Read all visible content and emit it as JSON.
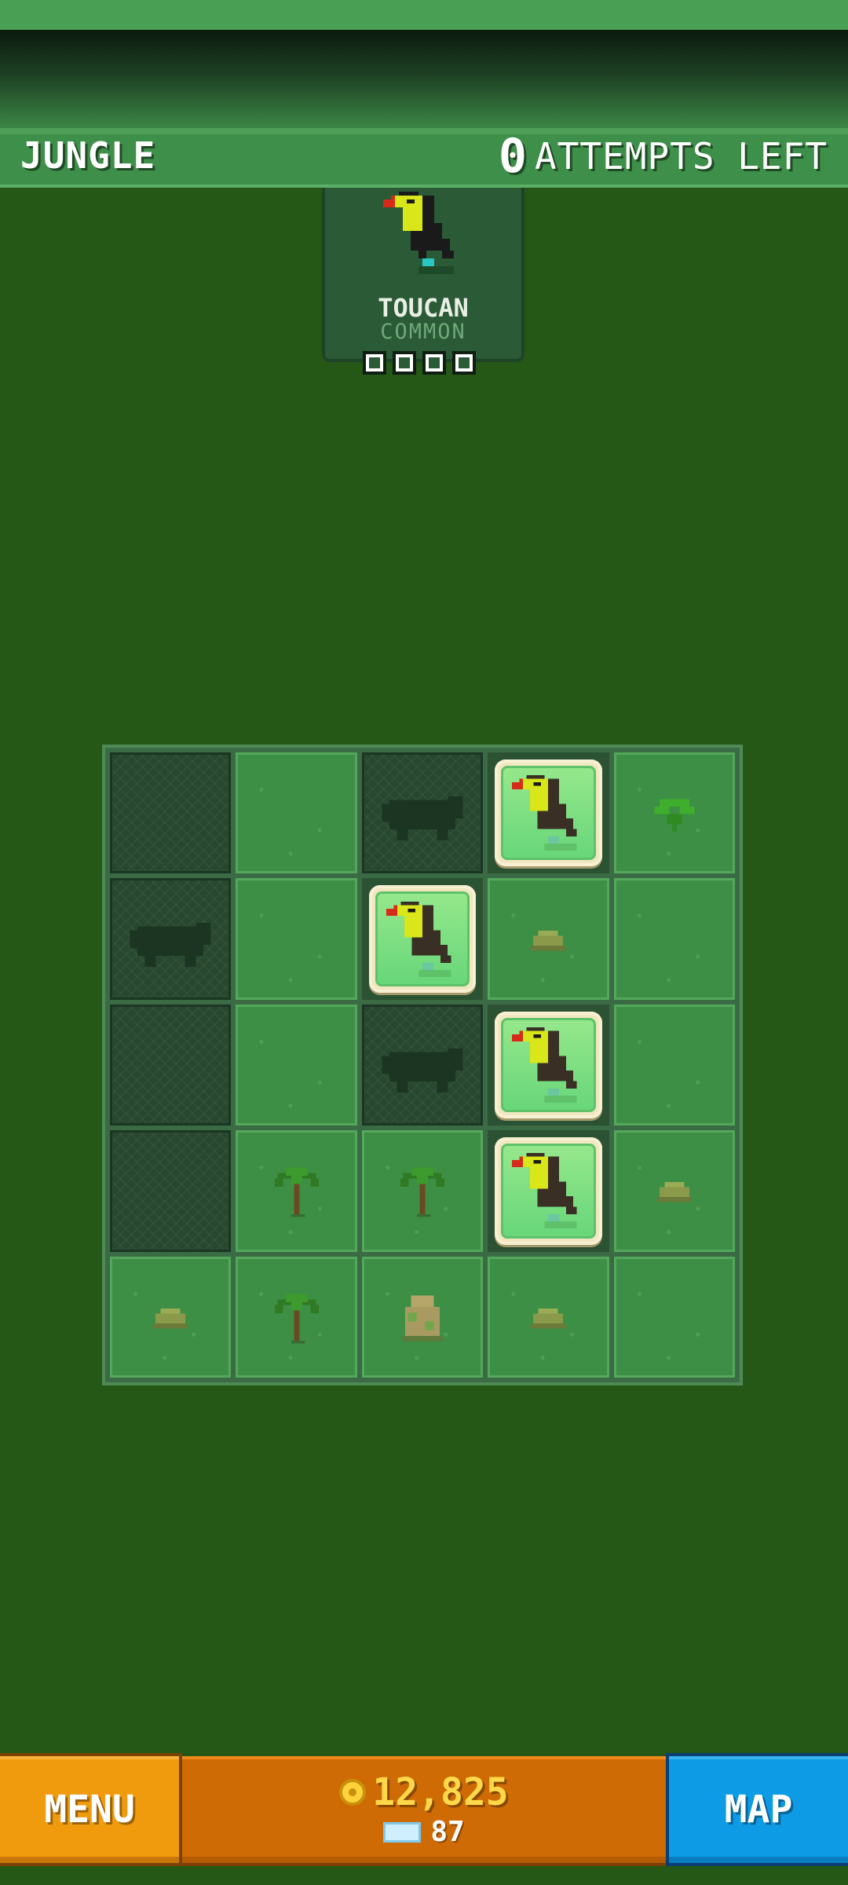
{
  "header": {
    "biome_name": "JUNGLE",
    "attempts_count": "0",
    "attempts_label": "ATTEMPTS LEFT"
  },
  "animal_card": {
    "name": "TOUCAN",
    "rarity": "COMMON",
    "icon": "toucan-icon",
    "progress_boxes_total": 4,
    "progress_boxes_filled": 0
  },
  "board": {
    "rows": 5,
    "cols": 5,
    "legend": {
      "covered": "unrevealed tile",
      "hippo": "revealed hippo silhouette",
      "toucan": "found toucan",
      "grass": "empty grass",
      "fern": "fern plant",
      "rock": "rock",
      "palm": "palm tree",
      "boulder": "boulder"
    },
    "grid": [
      [
        "covered",
        "grass",
        "hippo",
        "toucan",
        "fern"
      ],
      [
        "hippo",
        "grass",
        "toucan",
        "rock",
        "grass"
      ],
      [
        "covered",
        "grass",
        "hippo",
        "toucan",
        "grass"
      ],
      [
        "covered",
        "palm",
        "palm",
        "toucan",
        "rock"
      ],
      [
        "rock",
        "palm",
        "boulder",
        "rock",
        "grass"
      ]
    ]
  },
  "bottom_bar": {
    "menu_label": "MENU",
    "map_label": "MAP",
    "coins": "12,825",
    "gems": "87"
  },
  "colors": {
    "background": "#255816",
    "menu_button": "#f09a0e",
    "map_button": "#0d9be6",
    "currency_panel": "#cf6b05",
    "coins_text": "#ffd84a"
  }
}
